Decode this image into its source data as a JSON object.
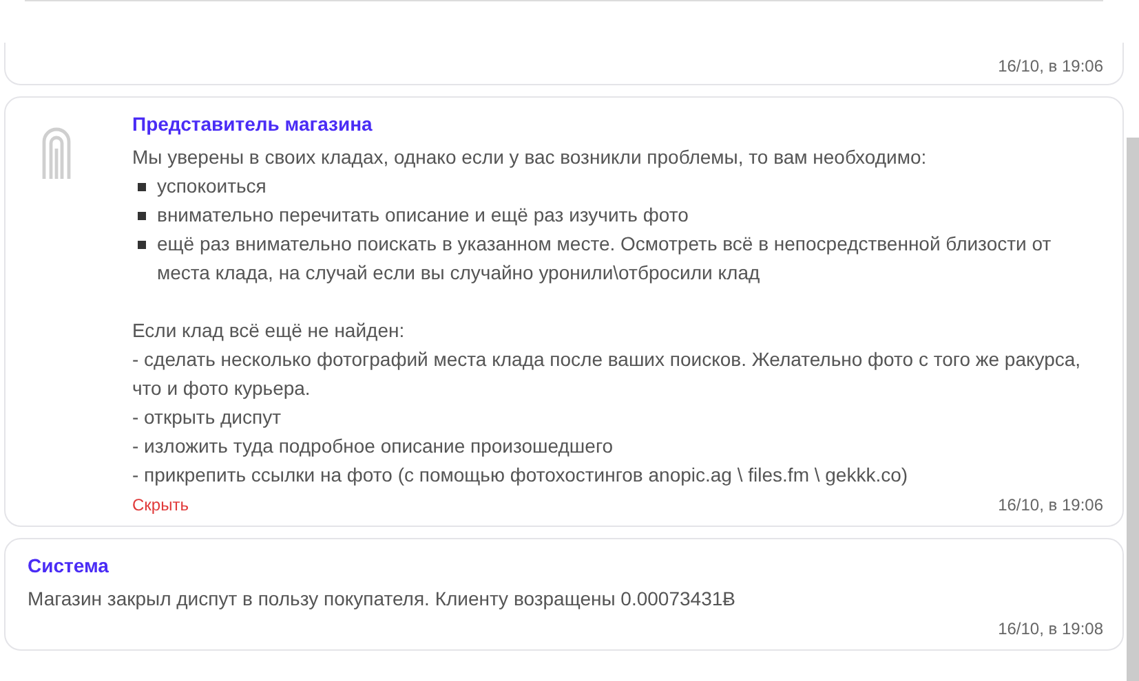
{
  "messages": [
    {
      "kind": "cut",
      "time": "16/10, в 19:06"
    },
    {
      "kind": "shop",
      "author": "Представитель магазина",
      "blocks": [
        {
          "kind": "text",
          "text": "Мы уверены в своих кладах, однако если у вас возникли проблемы, то вам необходимо:"
        },
        {
          "kind": "bullet",
          "text": "успокоиться"
        },
        {
          "kind": "bullet",
          "text": "внимательно перечитать описание и ещё раз изучить фото"
        },
        {
          "kind": "bullet",
          "text": "ещё раз внимательно поискать в указанном месте. Осмотреть всё в непосредственной близости от места клада, на случай если вы случайно уронили\\отбросили клад"
        },
        {
          "kind": "gap"
        },
        {
          "kind": "text",
          "text": "Если клад всё ещё не найден:"
        },
        {
          "kind": "text",
          "text": "- сделать несколько фотографий места клада после ваших поисков. Желательно фото с того же ракурса, что и фото курьера."
        },
        {
          "kind": "text",
          "text": "- открыть диспут"
        },
        {
          "kind": "text",
          "text": "- изложить туда подробное описание произошедшего"
        },
        {
          "kind": "text",
          "text": "- прикрепить ссылки на фото (с помощью фотохостингов anopic.ag \\ files.fm \\ gekkk.co)"
        }
      ],
      "action": "Скрыть",
      "time": "16/10, в 19:06"
    },
    {
      "kind": "system",
      "author": "Система",
      "blocks": [
        {
          "kind": "text",
          "text": "Магазин закрыл диспут в пользу покупателя. Клиенту возращены 0.00073431Ƀ"
        }
      ],
      "time": "16/10, в 19:08"
    }
  ]
}
